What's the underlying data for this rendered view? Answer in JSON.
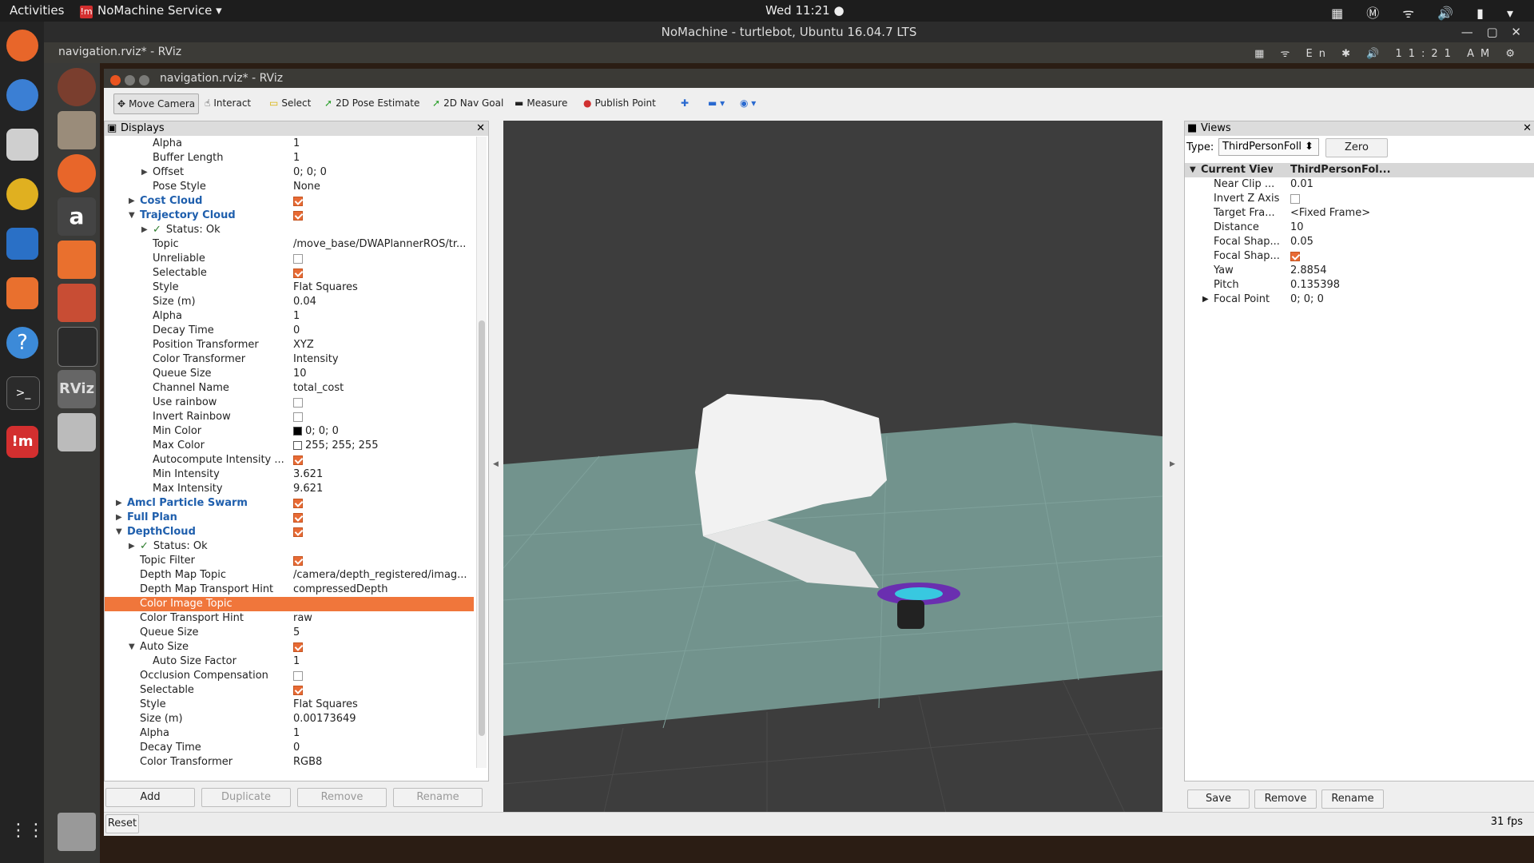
{
  "host": {
    "activities": "Activities",
    "app_menu": "NoMachine Service",
    "clock": "Wed 11:21",
    "nomachine_title": "NoMachine - turtlebot, Ubuntu 16.04.7 LTS"
  },
  "remote": {
    "window_title": "navigation.rviz* - RViz",
    "lang": "En",
    "time": "11:21 AM"
  },
  "rviz": {
    "title": "navigation.rviz* - RViz",
    "toolbar": {
      "move_camera": "Move Camera",
      "interact": "Interact",
      "select": "Select",
      "pose_estimate": "2D Pose Estimate",
      "nav_goal": "2D Nav Goal",
      "measure": "Measure",
      "publish_point": "Publish Point"
    },
    "displays": {
      "title": "Displays",
      "rows": [
        {
          "k": "Alpha",
          "v": "1"
        },
        {
          "k": "Buffer Length",
          "v": "1"
        },
        {
          "k": "Offset",
          "v": "0; 0; 0"
        },
        {
          "k": "Pose Style",
          "v": "None"
        },
        {
          "k": "Cost Cloud"
        },
        {
          "k": "Trajectory Cloud"
        },
        {
          "k": "Status: Ok"
        },
        {
          "k": "Topic",
          "v": "/move_base/DWAPlannerROS/tr..."
        },
        {
          "k": "Unreliable"
        },
        {
          "k": "Selectable"
        },
        {
          "k": "Style",
          "v": "Flat Squares"
        },
        {
          "k": "Size (m)",
          "v": "0.04"
        },
        {
          "k": "Alpha",
          "v": "1"
        },
        {
          "k": "Decay Time",
          "v": "0"
        },
        {
          "k": "Position Transformer",
          "v": "XYZ"
        },
        {
          "k": "Color Transformer",
          "v": "Intensity"
        },
        {
          "k": "Queue Size",
          "v": "10"
        },
        {
          "k": "Channel Name",
          "v": "total_cost"
        },
        {
          "k": "Use rainbow"
        },
        {
          "k": "Invert Rainbow"
        },
        {
          "k": "Min Color",
          "v": "0; 0; 0"
        },
        {
          "k": "Max Color",
          "v": "255; 255; 255"
        },
        {
          "k": "Autocompute Intensity ..."
        },
        {
          "k": "Min Intensity",
          "v": "3.621"
        },
        {
          "k": "Max Intensity",
          "v": "9.621"
        },
        {
          "k": "Amcl Particle Swarm"
        },
        {
          "k": "Full Plan"
        },
        {
          "k": "DepthCloud"
        },
        {
          "k": "Status: Ok"
        },
        {
          "k": "Topic Filter"
        },
        {
          "k": "Depth Map Topic",
          "v": "/camera/depth_registered/imag..."
        },
        {
          "k": "Depth Map Transport Hint",
          "v": "compressedDepth"
        },
        {
          "k": "Color Image Topic",
          "v": ""
        },
        {
          "k": "Color Transport Hint",
          "v": "raw"
        },
        {
          "k": "Queue Size",
          "v": "5"
        },
        {
          "k": "Auto Size"
        },
        {
          "k": "Auto Size Factor",
          "v": "1"
        },
        {
          "k": "Occlusion Compensation"
        },
        {
          "k": "Selectable"
        },
        {
          "k": "Style",
          "v": "Flat Squares"
        },
        {
          "k": "Size (m)",
          "v": "0.00173649"
        },
        {
          "k": "Alpha",
          "v": "1"
        },
        {
          "k": "Decay Time",
          "v": "0"
        },
        {
          "k": "Color Transformer",
          "v": "RGB8"
        }
      ],
      "buttons": {
        "add": "Add",
        "duplicate": "Duplicate",
        "remove": "Remove",
        "rename": "Rename"
      }
    },
    "views": {
      "title": "Views",
      "type_label": "Type:",
      "type_value": "ThirdPersonFoll",
      "zero": "Zero",
      "rows": [
        {
          "k": "Current View",
          "v": "ThirdPersonFol..."
        },
        {
          "k": "Near Clip ...",
          "v": "0.01"
        },
        {
          "k": "Invert Z Axis"
        },
        {
          "k": "Target Fra...",
          "v": "<Fixed Frame>"
        },
        {
          "k": "Distance",
          "v": "10"
        },
        {
          "k": "Focal Shap...",
          "v": "0.05"
        },
        {
          "k": "Focal Shap..."
        },
        {
          "k": "Yaw",
          "v": "2.8854"
        },
        {
          "k": "Pitch",
          "v": "0.135398"
        },
        {
          "k": "Focal Point",
          "v": "0; 0; 0"
        }
      ],
      "buttons": {
        "save": "Save",
        "remove": "Remove",
        "rename": "Rename"
      }
    },
    "reset": "Reset",
    "fps": "31 fps"
  }
}
